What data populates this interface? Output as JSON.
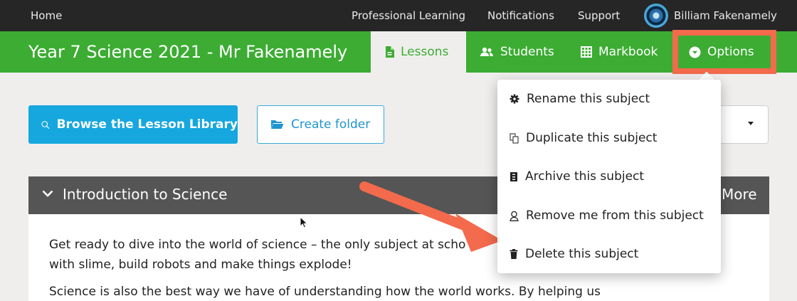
{
  "topnav": {
    "home": "Home",
    "links": [
      "Professional Learning",
      "Notifications",
      "Support"
    ],
    "user": "Billiam Fakenamely"
  },
  "subject": {
    "title": "Year 7 Science 2021 - Mr Fakenamely",
    "tabs": [
      {
        "label": "Lessons",
        "icon": "document-icon",
        "active": true
      },
      {
        "label": "Students",
        "icon": "users-icon",
        "active": false
      },
      {
        "label": "Markbook",
        "icon": "grid-icon",
        "active": false
      },
      {
        "label": "Options",
        "icon": "chevron-circle-down-icon",
        "active": false
      }
    ]
  },
  "toolbar": {
    "browse_label": "Browse the Lesson Library",
    "folder_label": "Create folder"
  },
  "options_menu": {
    "items": [
      {
        "label": "Rename this subject",
        "icon": "gear-icon"
      },
      {
        "label": "Duplicate this subject",
        "icon": "copy-icon"
      },
      {
        "label": "Archive this subject",
        "icon": "archive-icon"
      },
      {
        "label": "Remove me from this subject",
        "icon": "user-icon"
      },
      {
        "label": "Delete this subject",
        "icon": "trash-icon"
      }
    ]
  },
  "section": {
    "title": "Introduction to Science",
    "more_label": "More",
    "paragraphs": [
      "Get ready to dive into the world of science – the only subject at scho",
      "with slime, build robots and make things explode!",
      "Science is also the best way we have of understanding how the world works. By helping us"
    ]
  },
  "colors": {
    "topbar": "#262626",
    "green": "#3cac33",
    "blue": "#16a7de",
    "annotation": "#f36a4c",
    "panel_header": "#555555"
  }
}
